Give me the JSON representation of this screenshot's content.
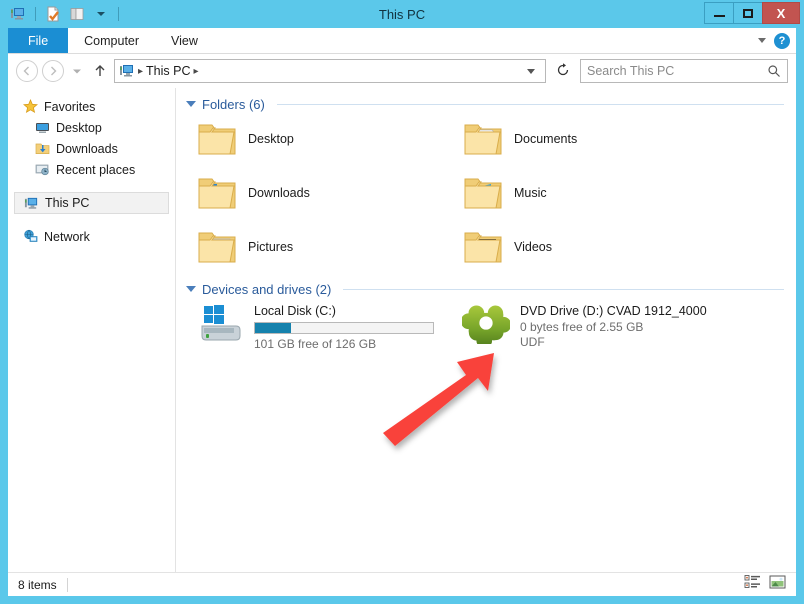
{
  "window": {
    "title": "This PC",
    "titlebar_color": "#5bc8ea",
    "close_color": "#c25450",
    "quick_access": [
      {
        "name": "computer-icon",
        "label": "This PC"
      },
      {
        "name": "properties-icon",
        "label": "Properties"
      },
      {
        "name": "new-folder-icon",
        "label": "New folder"
      },
      {
        "name": "customize-quick-access-icon",
        "label": "Customize Quick Access Toolbar"
      }
    ],
    "controls": {
      "minimize": "Minimize",
      "maximize": "Maximize",
      "close": "X"
    }
  },
  "ribbon": {
    "tabs": [
      {
        "label": "File",
        "selected": true
      },
      {
        "label": "Computer",
        "selected": false
      },
      {
        "label": "View",
        "selected": false
      }
    ],
    "expand_icon": "chevron-down-icon",
    "help_label": "?"
  },
  "address": {
    "back_glyph": "←",
    "forward_glyph": "→",
    "recent_glyph": "▾",
    "up_glyph": "↑",
    "crumb_icon": "computer-icon",
    "crumb_text": "This PC",
    "crumb_sep": "▸",
    "refresh_glyph": "↻",
    "history_glyph": "⌄"
  },
  "search": {
    "placeholder": "Search This PC",
    "icon": "search-icon"
  },
  "sidebar": {
    "items": [
      {
        "label": "Favorites",
        "icon": "star-icon",
        "level": 0,
        "selected": false
      },
      {
        "label": "Desktop",
        "icon": "desktop-icon",
        "level": 1,
        "selected": false
      },
      {
        "label": "Downloads",
        "icon": "downloads-folder-icon",
        "level": 1,
        "selected": false
      },
      {
        "label": "Recent places",
        "icon": "recent-places-icon",
        "level": 1,
        "selected": false
      },
      {
        "label": "This PC",
        "icon": "computer-icon",
        "level": 0,
        "selected": true
      },
      {
        "label": "Network",
        "icon": "network-icon",
        "level": 0,
        "selected": false
      }
    ]
  },
  "main": {
    "sections": [
      {
        "title": "Folders (6)",
        "collapse_icon": "collapse-triangle-icon",
        "items": [
          {
            "label": "Desktop",
            "icon": "folder-desktop-icon"
          },
          {
            "label": "Documents",
            "icon": "folder-documents-icon"
          },
          {
            "label": "Downloads",
            "icon": "folder-downloads-icon"
          },
          {
            "label": "Music",
            "icon": "folder-music-icon"
          },
          {
            "label": "Pictures",
            "icon": "folder-pictures-icon"
          },
          {
            "label": "Videos",
            "icon": "folder-videos-icon"
          }
        ]
      },
      {
        "title": "Devices and drives (2)",
        "collapse_icon": "collapse-triangle-icon",
        "items": [
          {
            "label": "Local Disk (C:)",
            "icon": "hard-drive-icon",
            "capacity_text": "101 GB free of 126 GB",
            "used_percent": 20,
            "bar_color": "#1682ad"
          },
          {
            "label": "DVD Drive (D:) CVAD 1912_4000",
            "icon": "udf-disc-icon",
            "capacity_text": "0 bytes free of 2.55 GB",
            "filesystem": "UDF"
          }
        ]
      }
    ]
  },
  "status": {
    "item_count": "8 items",
    "views": [
      {
        "name": "details-view-button",
        "label": "Details view"
      },
      {
        "name": "large-icons-view-button",
        "label": "Large icons view"
      }
    ]
  },
  "annotation": {
    "arrow_color": "#f9423a",
    "description": "red arrow pointing to DVD Drive (D:) icon"
  }
}
